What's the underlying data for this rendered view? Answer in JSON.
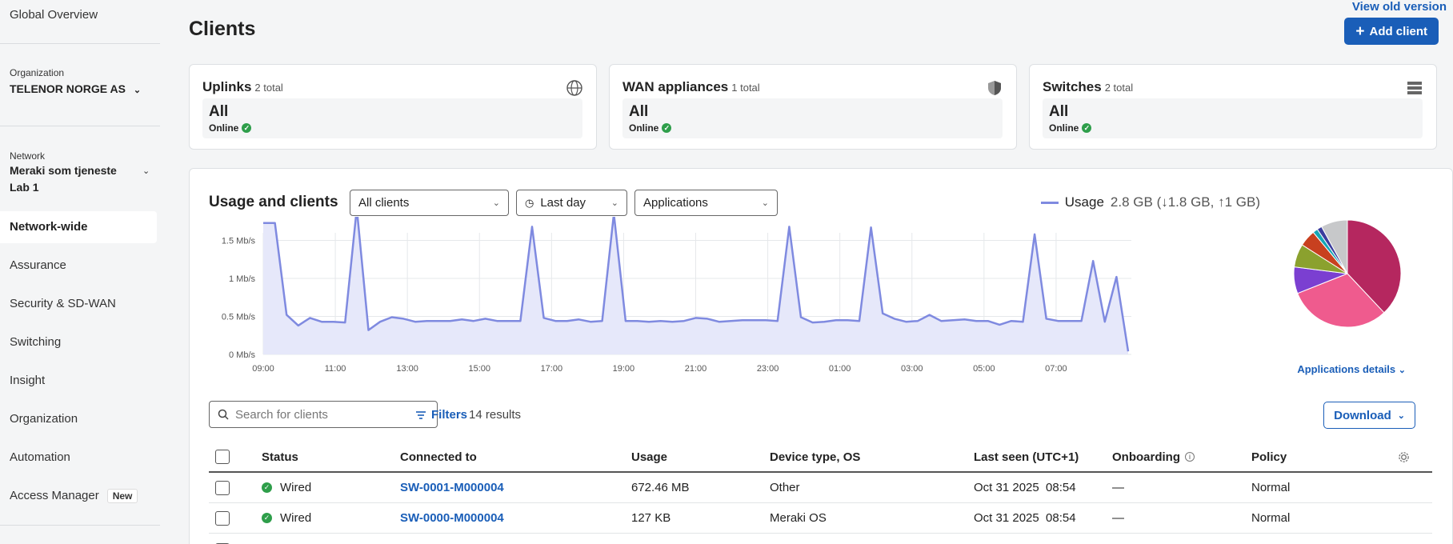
{
  "sidebar": {
    "global_overview": "Global Overview",
    "organization_label": "Organization",
    "organization_value": "TELENOR NORGE AS",
    "network_label": "Network",
    "network_value_line1": "Meraki som tjeneste",
    "network_value_line2": "Lab 1",
    "items": [
      {
        "label": "Network-wide"
      },
      {
        "label": "Assurance"
      },
      {
        "label": "Security & SD-WAN"
      },
      {
        "label": "Switching"
      },
      {
        "label": "Insight"
      },
      {
        "label": "Organization"
      },
      {
        "label": "Automation"
      },
      {
        "label": "Access Manager",
        "badge": "New"
      }
    ]
  },
  "header": {
    "title": "Clients",
    "view_old": "View old version",
    "add_client": "Add client"
  },
  "cards": [
    {
      "title": "Uplinks",
      "total": "2 total",
      "value": "All",
      "status": "Online",
      "icon": "globe-icon"
    },
    {
      "title": "WAN appliances",
      "total": "1 total",
      "value": "All",
      "status": "Online",
      "icon": "shield-icon"
    },
    {
      "title": "Switches",
      "total": "2 total",
      "value": "All",
      "status": "Online",
      "icon": "switch-stack-icon"
    }
  ],
  "usage": {
    "title": "Usage and clients",
    "filter_clients": "All clients",
    "filter_time": "Last day",
    "filter_view": "Applications",
    "legend_label": "Usage",
    "legend_value": "2.8 GB (↓1.8 GB, ↑1 GB)",
    "applications_details": "Applications details"
  },
  "chart_data": {
    "type": "area",
    "ylabel": "",
    "ylim": [
      0,
      1.6
    ],
    "y_ticks": [
      "0 Mb/s",
      "0.5 Mb/s",
      "1 Mb/s",
      "1.5 Mb/s"
    ],
    "x_ticks": [
      "09:00",
      "11:00",
      "13:00",
      "15:00",
      "17:00",
      "19:00",
      "21:00",
      "23:00",
      "01:00",
      "03:00",
      "05:00",
      "07:00"
    ],
    "series": [
      {
        "color": "#7f8ae0",
        "values": [
          1.73,
          1.73,
          0.52,
          0.38,
          0.48,
          0.43,
          0.43,
          0.42,
          1.92,
          0.32,
          0.43,
          0.49,
          0.47,
          0.43,
          0.44,
          0.44,
          0.44,
          0.46,
          0.44,
          0.47,
          0.44,
          0.44,
          0.44,
          1.68,
          0.48,
          0.44,
          0.44,
          0.46,
          0.43,
          0.44,
          1.85,
          0.44,
          0.44,
          0.43,
          0.44,
          0.43,
          0.44,
          0.48,
          0.47,
          0.43,
          0.44,
          0.45,
          0.45,
          0.45,
          0.44,
          1.68,
          0.49,
          0.42,
          0.43,
          0.45,
          0.45,
          0.44,
          1.67,
          0.54,
          0.47,
          0.43,
          0.44,
          0.52,
          0.44,
          0.45,
          0.46,
          0.44,
          0.44,
          0.39,
          0.44,
          0.43,
          1.58,
          0.47,
          0.44,
          0.44,
          0.44,
          1.23,
          0.43,
          1.02,
          0.04
        ]
      }
    ]
  },
  "pie_data": {
    "type": "pie",
    "slices": [
      {
        "value": 38,
        "color": "#b5275f"
      },
      {
        "value": 31,
        "color": "#ef5b8e"
      },
      {
        "value": 8,
        "color": "#7b3fd1"
      },
      {
        "value": 7,
        "color": "#8ba12e"
      },
      {
        "value": 5,
        "color": "#c8401f"
      },
      {
        "value": 1.5,
        "color": "#16a6b6"
      },
      {
        "value": 1.5,
        "color": "#3b3d9e"
      },
      {
        "value": 8,
        "color": "#c7c8ca"
      }
    ]
  },
  "table": {
    "search_placeholder": "Search for clients",
    "filters_label": "Filters",
    "results": "14 results",
    "download": "Download",
    "columns": [
      "Status",
      "Connected to",
      "Usage",
      "Device type, OS",
      "Last seen (UTC+1)",
      "Onboarding",
      "Policy"
    ],
    "rows": [
      {
        "status": "Wired",
        "connected_to": "SW-0001-M000004",
        "usage": "672.46 MB",
        "device": "Other",
        "last_seen": "Oct 31 2025  08:54",
        "onboarding": "—",
        "policy": "Normal"
      },
      {
        "status": "Wired",
        "connected_to": "SW-0000-M000004",
        "usage": "127 KB",
        "device": "Meraki OS",
        "last_seen": "Oct 31 2025  08:54",
        "onboarding": "—",
        "policy": "Normal"
      }
    ]
  }
}
